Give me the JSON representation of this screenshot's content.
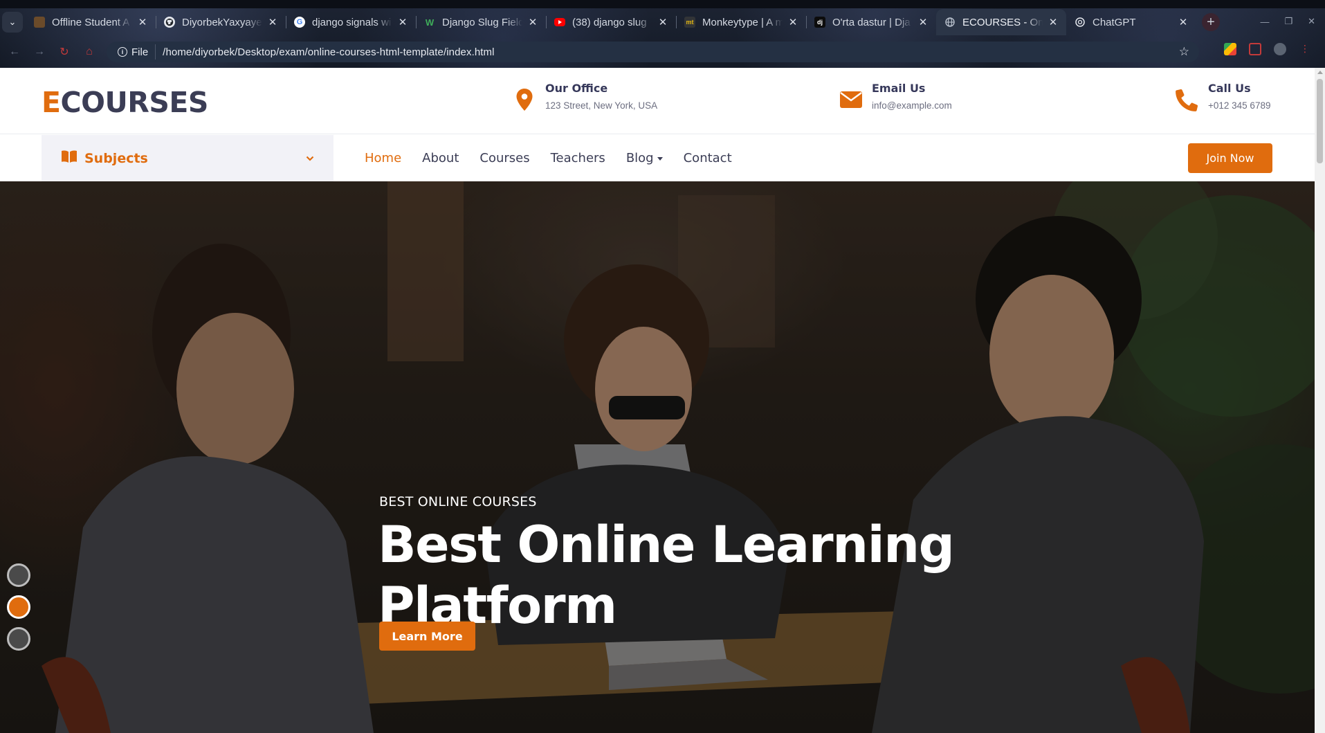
{
  "browser": {
    "tabs": [
      {
        "title": "Offline Student A",
        "favicon_color": "#6b4b2a",
        "favicon_glyph": "",
        "active": false
      },
      {
        "title": "DiyorbekYaxyaye",
        "favicon_color": "#1f2328",
        "favicon_glyph": "",
        "active": false
      },
      {
        "title": "django signals wi",
        "favicon_color": "#ffffff",
        "favicon_glyph": "G",
        "active": false
      },
      {
        "title": "Django Slug Field",
        "favicon_color": "#2f6f3a",
        "favicon_glyph": "",
        "active": false
      },
      {
        "title": "(38) django slug",
        "favicon_color": "#ff0000",
        "favicon_glyph": "",
        "active": false
      },
      {
        "title": "Monkeytype | A m",
        "favicon_color": "#323437",
        "favicon_glyph": "mt",
        "active": false
      },
      {
        "title": "O'rta dastur | Dja",
        "favicon_color": "#0c4b33",
        "favicon_glyph": "dj",
        "active": false
      },
      {
        "title": "ECOURSES - Onli",
        "favicon_color": "#9aa3b2",
        "favicon_glyph": "",
        "active": true
      },
      {
        "title": "ChatGPT",
        "favicon_color": "#ffffff",
        "favicon_glyph": "",
        "active": false
      }
    ],
    "omnibox": {
      "chip_label": "File",
      "url": "/home/diyorbek/Desktop/exam/online-courses-html-template/index.html"
    }
  },
  "topbar": {
    "logo_first": "E",
    "logo_rest": "COURSES",
    "office": {
      "label": "Our Office",
      "value": "123 Street, New York, USA"
    },
    "email": {
      "label": "Email Us",
      "value": "info@example.com"
    },
    "call": {
      "label": "Call Us",
      "value": "+012 345 6789"
    }
  },
  "nav": {
    "subjects_label": "Subjects",
    "items": [
      "Home",
      "About",
      "Courses",
      "Teachers",
      "Blog",
      "Contact"
    ],
    "active_index": 0,
    "join_label": "Join Now"
  },
  "hero": {
    "eyebrow": "BEST ONLINE COURSES",
    "title_line1": "Best Online Learning",
    "title_line2": "Platform",
    "cta_label": "Learn More",
    "slides": 3,
    "active_slide": 2
  },
  "colors": {
    "accent": "#e06c0e",
    "text_dark": "#3b3d55",
    "text_muted": "#6c6e80",
    "subjects_bg": "#f2f2f7"
  }
}
